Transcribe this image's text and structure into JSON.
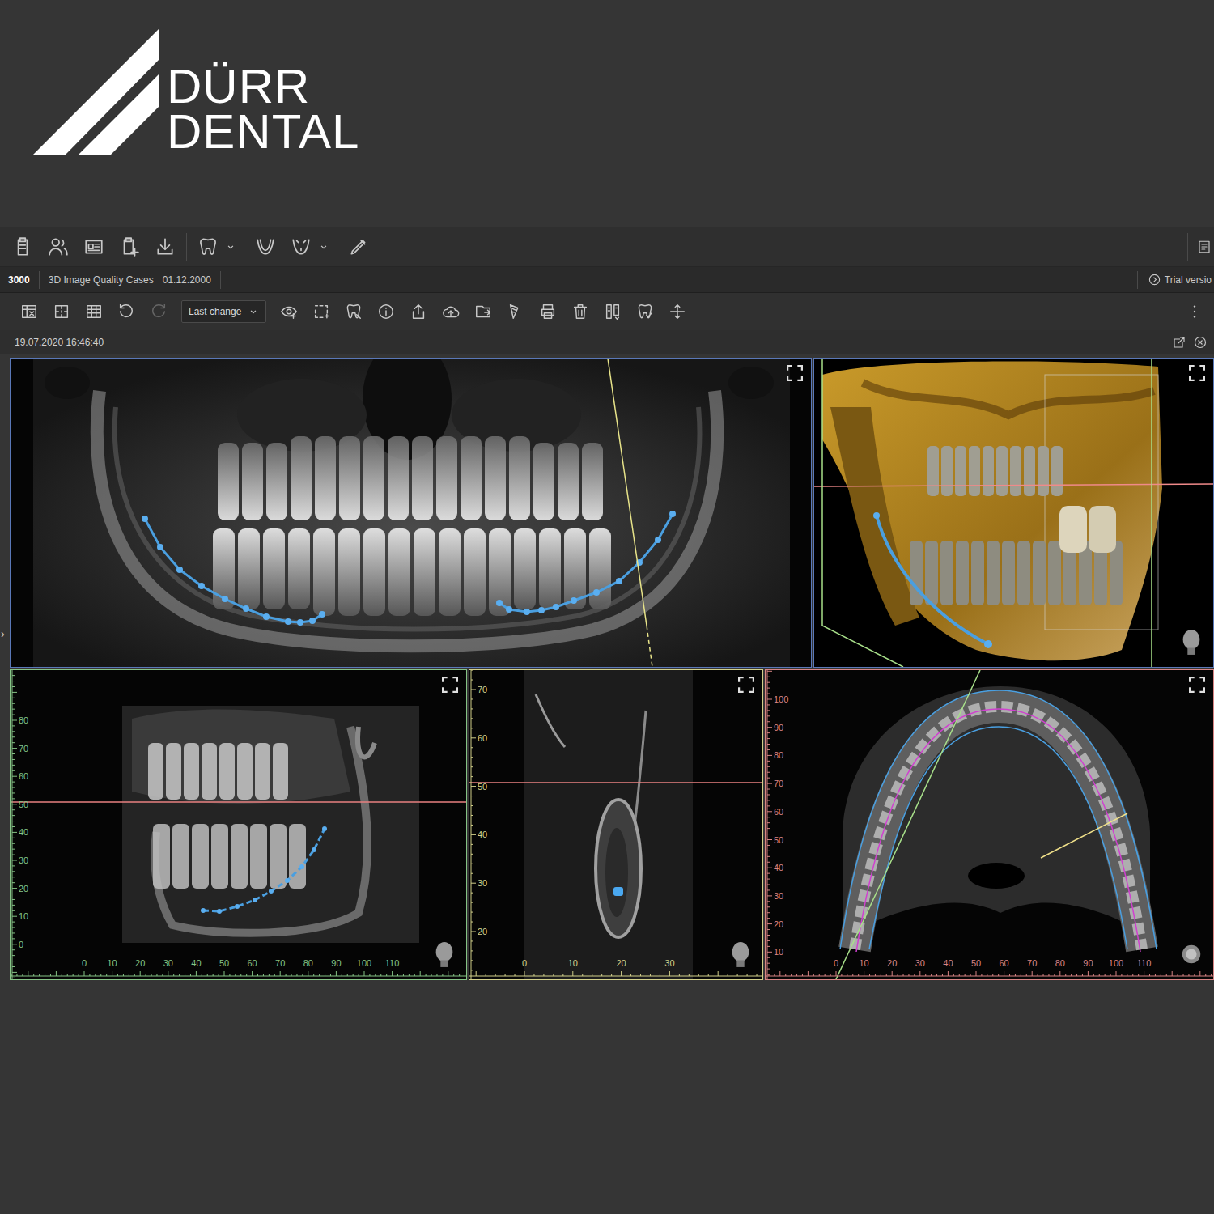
{
  "logo": {
    "lines": [
      "DÜRR",
      "DENTAL"
    ]
  },
  "case_bar": {
    "id": "3000",
    "title": "3D Image Quality Cases",
    "date": "01.12.2000",
    "license": "Trial versio"
  },
  "image_toolbar": {
    "history": "Last change",
    "redo_disabled": true
  },
  "session": {
    "timestamp": "19.07.2020 16:46:40"
  },
  "side_toggle": "›",
  "top_views": [
    {
      "kind": "panorama",
      "color": "#5a78b8"
    },
    {
      "kind": "volume",
      "color": "#5a78b8"
    }
  ],
  "slice_views": [
    {
      "kind": "sagittal",
      "color": "#86c486",
      "x_ticks": [
        "0",
        "10",
        "20",
        "30",
        "40",
        "50",
        "60",
        "70",
        "80",
        "90",
        "100",
        "110"
      ],
      "y_ticks": [
        "80",
        "70",
        "60",
        "50",
        "40",
        "30",
        "20",
        "10",
        "0"
      ]
    },
    {
      "kind": "cross",
      "color": "#d2d08a",
      "x_ticks": [
        "0",
        "10",
        "20",
        "30"
      ],
      "y_ticks": [
        "70",
        "60",
        "50",
        "40",
        "30",
        "20"
      ]
    },
    {
      "kind": "axial",
      "color": "#d88484",
      "x_ticks": [
        "0",
        "10",
        "20",
        "30",
        "40",
        "50",
        "60",
        "70",
        "80",
        "90",
        "100",
        "110"
      ],
      "y_ticks": [
        "100",
        "90",
        "80",
        "70",
        "60",
        "50",
        "40",
        "30",
        "20",
        "10"
      ]
    }
  ]
}
